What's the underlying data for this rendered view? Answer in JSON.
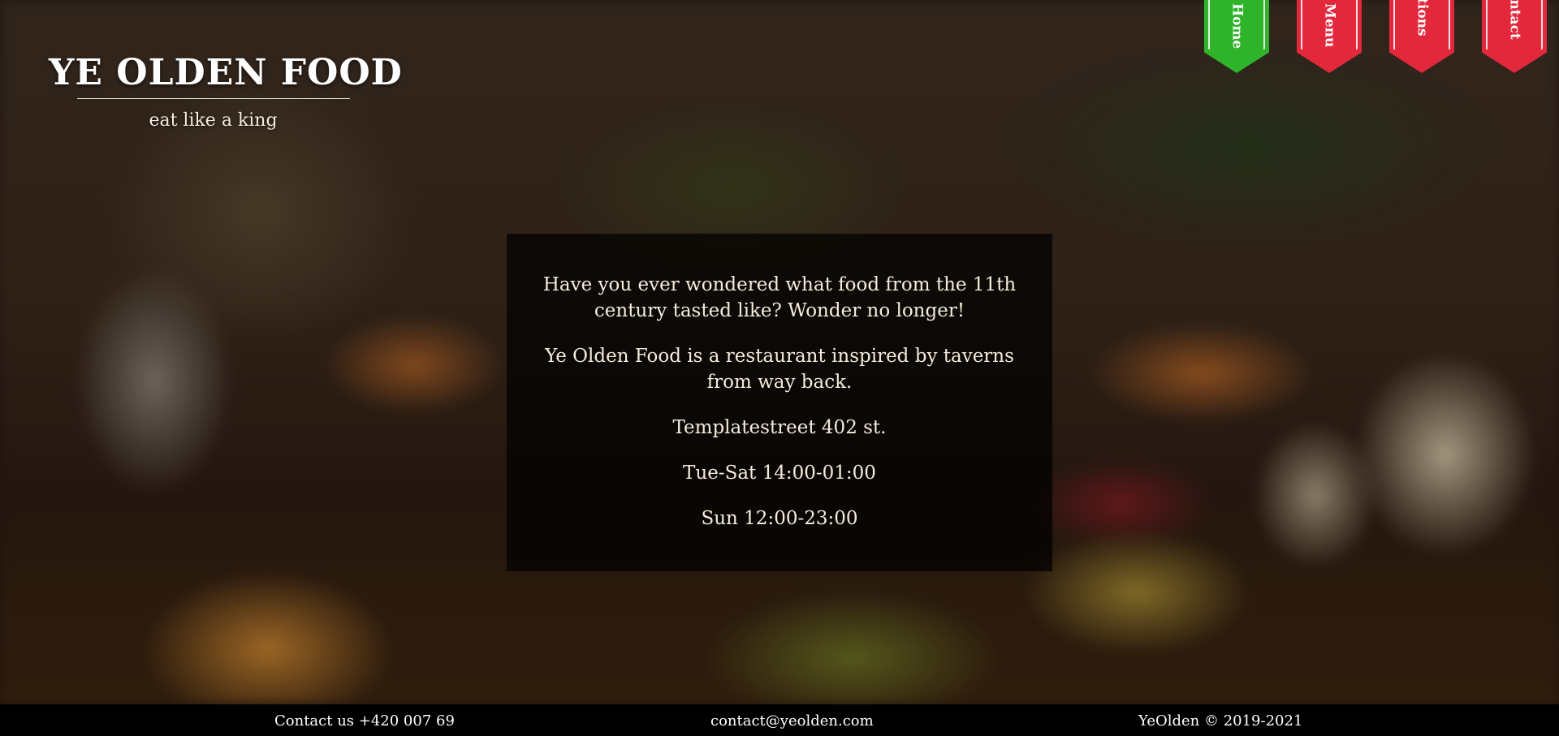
{
  "brand": {
    "title": "YE OLDEN FOOD",
    "tagline": "eat like a king"
  },
  "nav": {
    "items": [
      {
        "label": "Home",
        "active": true
      },
      {
        "label": "Menu",
        "active": false
      },
      {
        "label": "ations",
        "active": false
      },
      {
        "label": "ontact",
        "active": false
      }
    ]
  },
  "info": {
    "intro": "Have you ever wondered what food from the 11th century tasted like? Wonder no longer!",
    "about": "Ye Olden Food is a restaurant inspired by taverns from way back.",
    "address": "Templatestreet 402 st.",
    "hours_weekday": "Tue-Sat 14:00-01:00",
    "hours_sunday": "Sun 12:00-23:00"
  },
  "footer": {
    "phone": "Contact us +420 007 69",
    "email": "contact@yeolden.com",
    "copyright": "YeOlden © 2019-2021"
  },
  "colors": {
    "banner_active": "#2fb32a",
    "banner_inactive": "#e4283c",
    "footer_bg": "#000000"
  }
}
